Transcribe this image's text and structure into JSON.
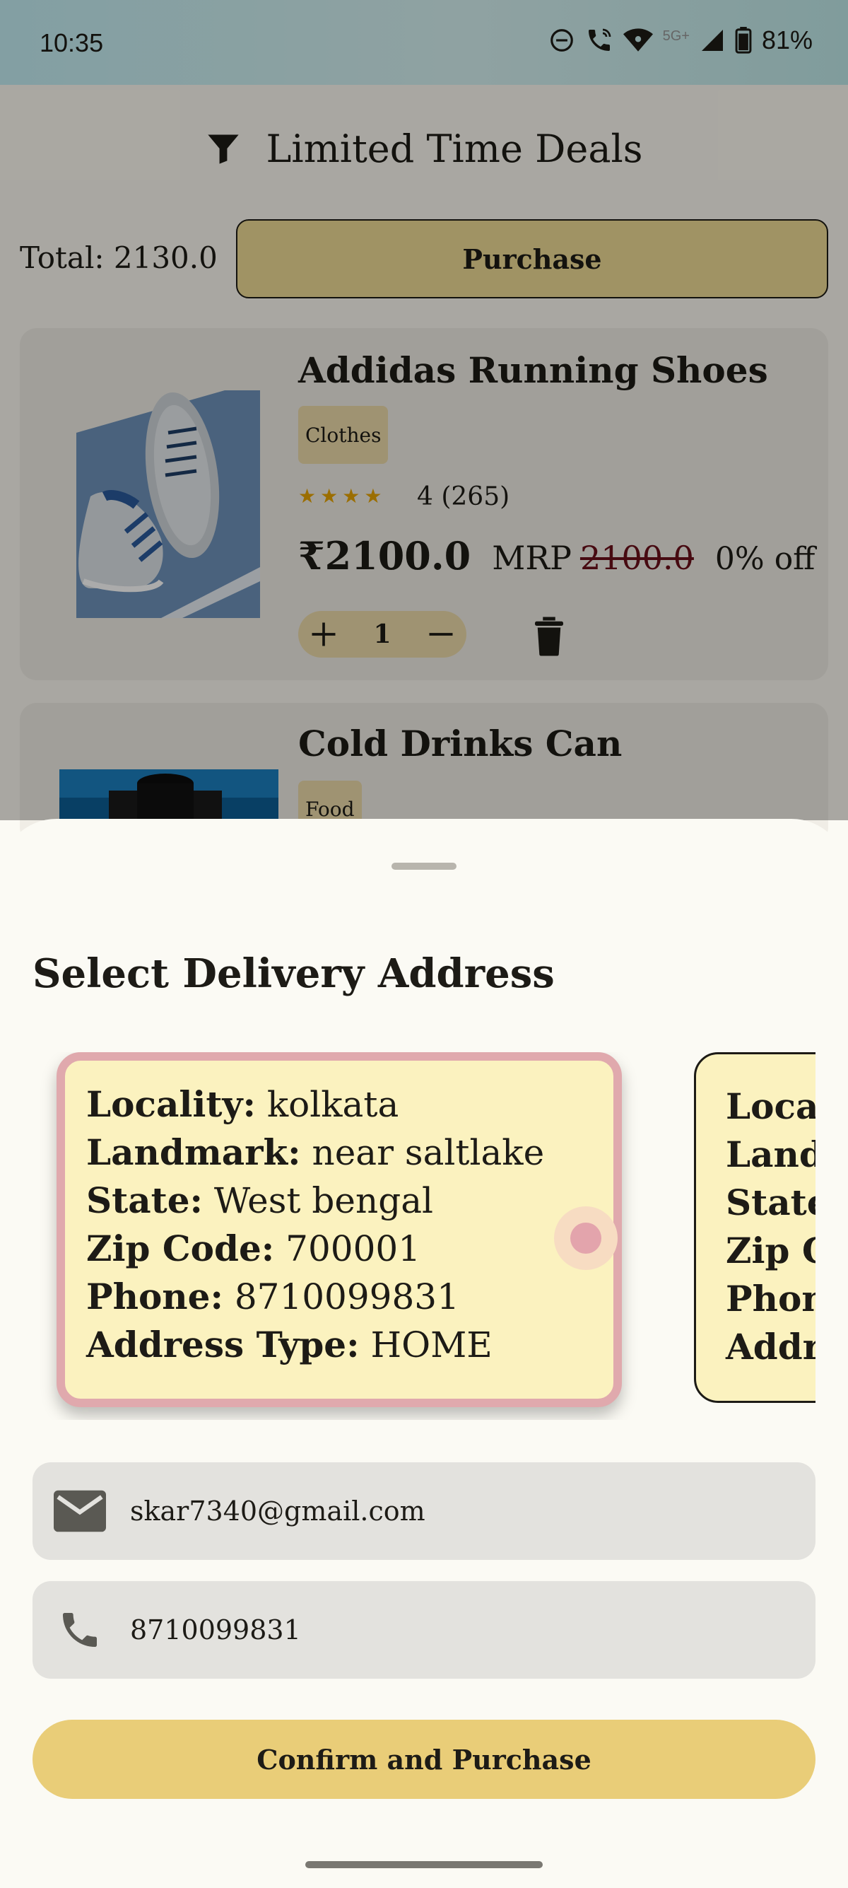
{
  "status_bar": {
    "time": "10:35",
    "network_label": "5G+",
    "battery": "81%",
    "icons": [
      "do-not-disturb-icon",
      "wifi-calling-icon",
      "wifi-icon",
      "signal-icon",
      "battery-icon"
    ]
  },
  "header": {
    "filter_icon": "filter-icon",
    "title": "Limited Time Deals"
  },
  "cart": {
    "total_label": "Total: 2130.0",
    "purchase_label": "Purchase"
  },
  "products": [
    {
      "name": "Addidas Running Shoes",
      "category": "Clothes",
      "rating_stars": 4,
      "rating_text": "4 (265)",
      "price": "₹2100.0",
      "mrp_label": "MRP",
      "mrp_value": "2100.0",
      "discount": "0% off",
      "quantity": "1"
    },
    {
      "name": "Cold Drinks Can",
      "category": "Food"
    }
  ],
  "sheet": {
    "title": "Select Delivery Address",
    "addresses": [
      {
        "selected": true,
        "lines": [
          {
            "label": "Locality:",
            "value": " kolkata"
          },
          {
            "label": "Landmark:",
            "value": " near saltlake"
          },
          {
            "label": "State:",
            "value": " West bengal"
          },
          {
            "label": "Zip Code:",
            "value": " 700001"
          },
          {
            "label": "Phone:",
            "value": " 8710099831"
          },
          {
            "label": "Address Type:",
            "value": " HOME"
          }
        ]
      },
      {
        "selected": false,
        "lines": [
          {
            "label": "Local",
            "value": ""
          },
          {
            "label": "Landi",
            "value": ""
          },
          {
            "label": "State",
            "value": ""
          },
          {
            "label": "Zip C",
            "value": ""
          },
          {
            "label": "Phon",
            "value": ""
          },
          {
            "label": "Addre",
            "value": ""
          }
        ]
      }
    ],
    "email": "skar7340@gmail.com",
    "phone": "8710099831",
    "confirm_label": "Confirm and Purchase"
  },
  "colors": {
    "accent": "#e9cd78",
    "selected_border": "#e0a9ad",
    "address_card_bg": "#fbf2bf",
    "mrp_strike": "#6b0f1a"
  }
}
